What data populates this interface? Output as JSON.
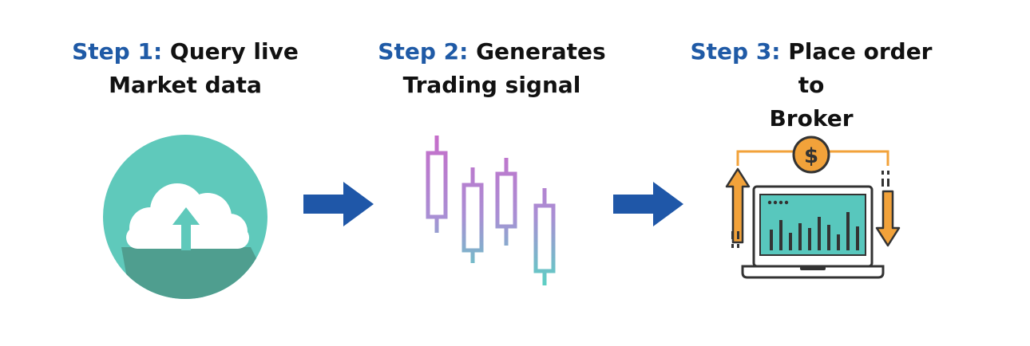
{
  "steps": [
    {
      "label": "Step 1:",
      "line1": "Query live",
      "line2": "Market data",
      "icon": "cloud-upload-icon"
    },
    {
      "label": "Step 2:",
      "line1": "Generates",
      "line2": "Trading signal",
      "icon": "candlestick-chart-icon"
    },
    {
      "label": "Step 3:",
      "line1": "Place order to",
      "line2": "Broker",
      "icon": "laptop-trading-icon"
    }
  ],
  "connectors": [
    "arrow-right-icon",
    "arrow-right-icon"
  ],
  "laptop": {
    "currency_symbol": "$"
  },
  "colors": {
    "step_label": "#1f5aa6",
    "step_text": "#111111",
    "arrow": "#1f57a8",
    "cloud_circle": "#5fc9bb",
    "cloud_shadow": "#4f9e8f",
    "candle_top": "#c06ac8",
    "candle_bottom": "#5ecfc4",
    "laptop_screen": "#58c7bd",
    "coin": "#f2a23a"
  }
}
